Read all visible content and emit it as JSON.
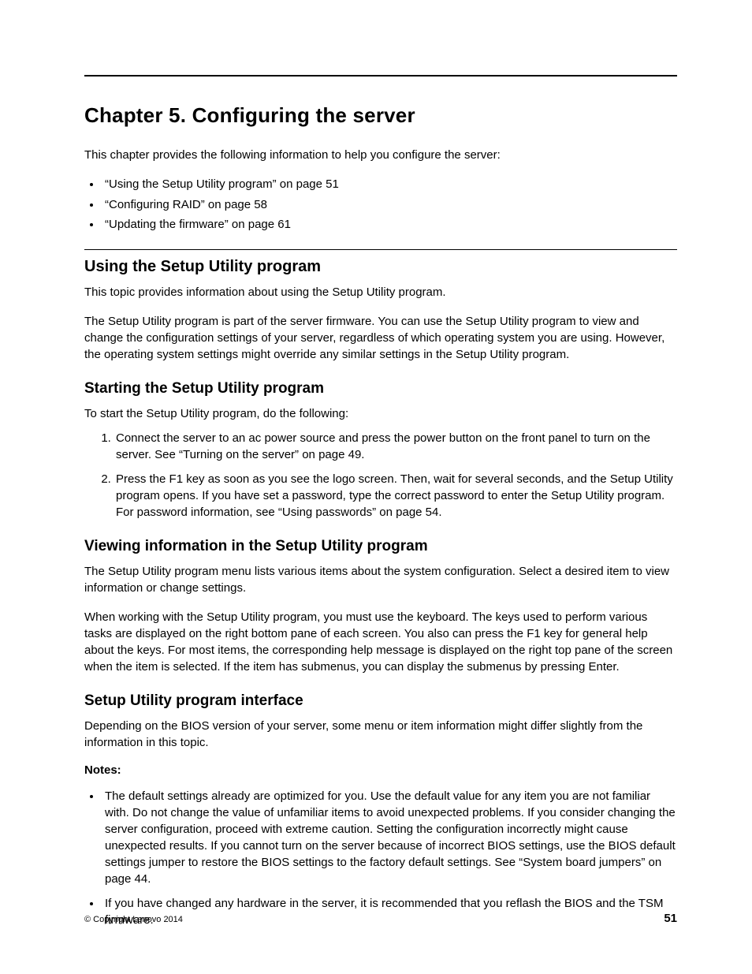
{
  "chapter_title": "Chapter 5.   Configuring the server",
  "intro": "This chapter provides the following information to help you configure the server:",
  "toc_bullets": [
    "“Using the Setup Utility program” on page 51",
    "“Configuring RAID” on page 58",
    "“Updating the firmware” on page 61"
  ],
  "section1": {
    "heading": "Using the Setup Utility program",
    "p1": "This topic provides information about using the Setup Utility program.",
    "p2": "The Setup Utility program is part of the server firmware. You can use the Setup Utility program to view and change the configuration settings of your server, regardless of which operating system you are using. However, the operating system settings might override any similar settings in the Setup Utility program."
  },
  "section2": {
    "heading": "Starting the Setup Utility program",
    "p1": "To start the Setup Utility program, do the following:",
    "steps": [
      "Connect the server to an ac power source and press the power button on the front panel to turn on the server. See “Turning on the server” on page 49.",
      "Press the F1 key as soon as you see the logo screen. Then, wait for several seconds, and the Setup Utility program opens. If you have set a password, type the correct password to enter the Setup Utility program. For password information, see “Using passwords” on page 54."
    ]
  },
  "section3": {
    "heading": "Viewing information in the Setup Utility program",
    "p1": "The Setup Utility program menu lists various items about the system configuration. Select a desired item to view information or change settings.",
    "p2": "When working with the Setup Utility program, you must use the keyboard. The keys used to perform various tasks are displayed on the right bottom pane of each screen. You also can press the F1 key for general help about the keys. For most items, the corresponding help message is displayed on the right top pane of the screen when the item is selected. If the item has submenus, you can display the submenus by pressing Enter."
  },
  "section4": {
    "heading": "Setup Utility program interface",
    "p1": "Depending on the BIOS version of your server, some menu or item information might differ slightly from the information in this topic.",
    "notes_label": "Notes:",
    "notes": [
      "The default settings already are optimized for you. Use the default value for any item you are not familiar with. Do not change the value of unfamiliar items to avoid unexpected problems. If you consider changing the server configuration, proceed with extreme caution. Setting the configuration incorrectly might cause unexpected results. If you cannot turn on the server because of incorrect BIOS settings, use the BIOS default settings jumper to restore the BIOS settings to the factory default settings. See “System board jumpers” on page 44.",
      "If you have changed any hardware in the server, it is recommended that you reflash the BIOS and the TSM firmware."
    ]
  },
  "footer": {
    "copyright": "© Copyright Lenovo 2014",
    "page_number": "51"
  }
}
